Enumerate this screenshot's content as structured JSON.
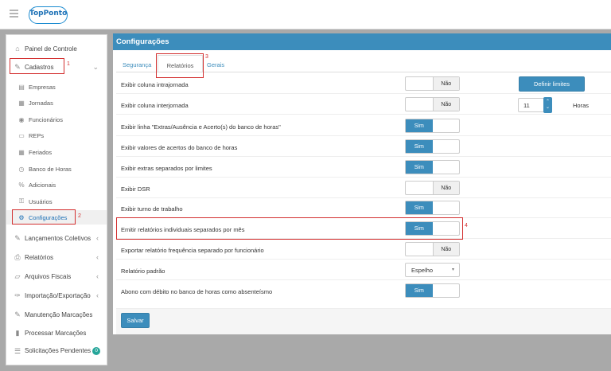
{
  "app": {
    "logo_top": "Top",
    "logo_ponto": "Ponto"
  },
  "sidebar": {
    "items": [
      {
        "label": "Painel de Controle",
        "icon": "home-icon"
      },
      {
        "label": "Cadastros",
        "icon": "pencil-icon",
        "marker": "1"
      },
      {
        "label": "Lançamentos Coletivos",
        "icon": "edit-icon"
      },
      {
        "label": "Relatórios",
        "icon": "printer-icon"
      },
      {
        "label": "Arquivos Fiscais",
        "icon": "folder-icon"
      },
      {
        "label": "Importação/Exportação",
        "icon": "wrench-icon"
      },
      {
        "label": "Manutenção Marcações",
        "icon": "edit-icon"
      },
      {
        "label": "Processar Marcações",
        "icon": "file-icon"
      },
      {
        "label": "Solicitações Pendentes",
        "icon": "list-icon",
        "badge": "0"
      }
    ],
    "sub_items": [
      {
        "label": "Empresas",
        "icon": "building-icon"
      },
      {
        "label": "Jornadas",
        "icon": "table-icon"
      },
      {
        "label": "Funcionários",
        "icon": "user-icon"
      },
      {
        "label": "REPs",
        "icon": "device-icon"
      },
      {
        "label": "Feriados",
        "icon": "calendar-icon"
      },
      {
        "label": "Banco de Horas",
        "icon": "clock-icon"
      },
      {
        "label": "Adicionais",
        "icon": "percent-icon"
      },
      {
        "label": "Usuários",
        "icon": "key-icon"
      },
      {
        "label": "Configurações",
        "icon": "gears-icon",
        "marker": "2"
      }
    ]
  },
  "panel": {
    "title": "Configurações",
    "tabs": [
      {
        "label": "Segurança"
      },
      {
        "label": "Relatórios",
        "marker": "3"
      },
      {
        "label": "Gerais"
      }
    ],
    "rows": [
      {
        "label": "Exibir coluna intrajornada",
        "on": "Sim",
        "off": "Não",
        "state": "off"
      },
      {
        "label": "Exibir coluna interjornada",
        "on": "Sim",
        "off": "Não",
        "state": "off"
      },
      {
        "label": "Exibir linha \"Extras/Ausência e Acerto(s) do banco de horas\"",
        "on": "Sim",
        "off": "Não",
        "state": "on"
      },
      {
        "label": "Exibir valores de acertos do banco de horas",
        "on": "Sim",
        "off": "Não",
        "state": "on"
      },
      {
        "label": "Exibir extras separados por limites",
        "on": "Sim",
        "off": "Não",
        "state": "on"
      },
      {
        "label": "Exibir DSR",
        "on": "Sim",
        "off": "Não",
        "state": "off"
      },
      {
        "label": "Exibir turno de trabalho",
        "on": "Sim",
        "off": "Não",
        "state": "on"
      },
      {
        "label": "Emitir relatórios individuais separados por mês",
        "on": "Sim",
        "off": "Não",
        "state": "on",
        "marker": "4"
      },
      {
        "label": "Exportar relatório frequência separado por funcionário",
        "on": "Sim",
        "off": "Não",
        "state": "off"
      },
      {
        "label": "Relatório padrão",
        "select": "Espelho"
      },
      {
        "label": "Abono com débito no banco de horas como absenteísmo",
        "on": "Sim",
        "off": "Não",
        "state": "on"
      }
    ],
    "define_limits_label": "Definir limites",
    "hours_value": "11",
    "hours_unit": "Horas",
    "save_label": "Salvar"
  },
  "colors": {
    "primary": "#3c8dbc",
    "highlight": "#d32f2f",
    "badge": "#26a69a"
  }
}
